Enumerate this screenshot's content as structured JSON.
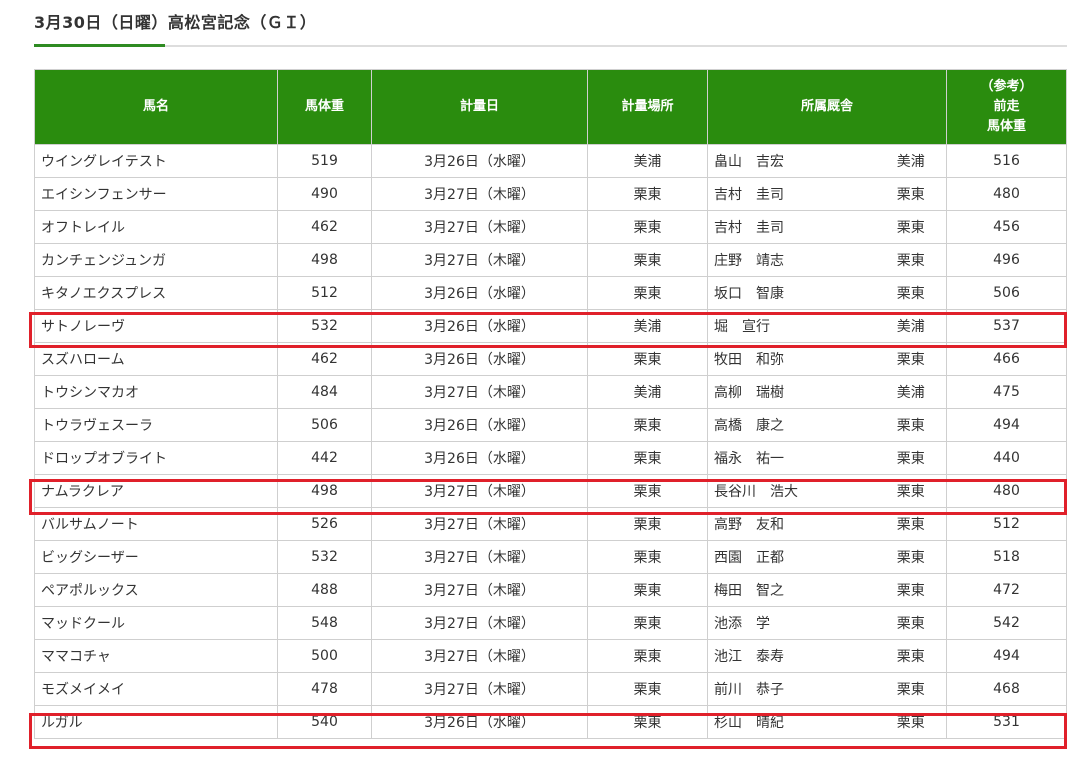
{
  "page_title": "3月30日（日曜）高松宮記念（ＧＩ）",
  "accent_color": "#2a8c0e",
  "highlight_color": "#e0202a",
  "table": {
    "headers": {
      "name": "馬名",
      "weight": "馬体重",
      "date": "計量日",
      "place": "計量場所",
      "stable": "所属厩舎",
      "prev_line1": "（参考）",
      "prev_line2": "前走",
      "prev_line3": "馬体重"
    },
    "rows": [
      {
        "name": "ウイングレイテスト",
        "weight": "519",
        "date": "3月26日（水曜）",
        "place": "美浦",
        "trainer": "畠山　吉宏",
        "base": "美浦",
        "prev": "516"
      },
      {
        "name": "エイシンフェンサー",
        "weight": "490",
        "date": "3月27日（木曜）",
        "place": "栗東",
        "trainer": "吉村　圭司",
        "base": "栗東",
        "prev": "480"
      },
      {
        "name": "オフトレイル",
        "weight": "462",
        "date": "3月27日（木曜）",
        "place": "栗東",
        "trainer": "吉村　圭司",
        "base": "栗東",
        "prev": "456"
      },
      {
        "name": "カンチェンジュンガ",
        "weight": "498",
        "date": "3月27日（木曜）",
        "place": "栗東",
        "trainer": "庄野　靖志",
        "base": "栗東",
        "prev": "496"
      },
      {
        "name": "キタノエクスプレス",
        "weight": "512",
        "date": "3月26日（水曜）",
        "place": "栗東",
        "trainer": "坂口　智康",
        "base": "栗東",
        "prev": "506"
      },
      {
        "name": "サトノレーヴ",
        "weight": "532",
        "date": "3月26日（水曜）",
        "place": "美浦",
        "trainer": "堀　宣行",
        "base": "美浦",
        "prev": "537"
      },
      {
        "name": "スズハローム",
        "weight": "462",
        "date": "3月26日（水曜）",
        "place": "栗東",
        "trainer": "牧田　和弥",
        "base": "栗東",
        "prev": "466"
      },
      {
        "name": "トウシンマカオ",
        "weight": "484",
        "date": "3月27日（木曜）",
        "place": "美浦",
        "trainer": "高柳　瑞樹",
        "base": "美浦",
        "prev": "475"
      },
      {
        "name": "トウラヴェスーラ",
        "weight": "506",
        "date": "3月26日（水曜）",
        "place": "栗東",
        "trainer": "高橋　康之",
        "base": "栗東",
        "prev": "494"
      },
      {
        "name": "ドロップオブライト",
        "weight": "442",
        "date": "3月26日（水曜）",
        "place": "栗東",
        "trainer": "福永　祐一",
        "base": "栗東",
        "prev": "440"
      },
      {
        "name": "ナムラクレア",
        "weight": "498",
        "date": "3月27日（木曜）",
        "place": "栗東",
        "trainer": "長谷川　浩大",
        "base": "栗東",
        "prev": "480"
      },
      {
        "name": "バルサムノート",
        "weight": "526",
        "date": "3月27日（木曜）",
        "place": "栗東",
        "trainer": "高野　友和",
        "base": "栗東",
        "prev": "512"
      },
      {
        "name": "ビッグシーザー",
        "weight": "532",
        "date": "3月27日（木曜）",
        "place": "栗東",
        "trainer": "西園　正都",
        "base": "栗東",
        "prev": "518"
      },
      {
        "name": "ペアポルックス",
        "weight": "488",
        "date": "3月27日（木曜）",
        "place": "栗東",
        "trainer": "梅田　智之",
        "base": "栗東",
        "prev": "472"
      },
      {
        "name": "マッドクール",
        "weight": "548",
        "date": "3月27日（木曜）",
        "place": "栗東",
        "trainer": "池添　学",
        "base": "栗東",
        "prev": "542"
      },
      {
        "name": "ママコチャ",
        "weight": "500",
        "date": "3月27日（木曜）",
        "place": "栗東",
        "trainer": "池江　泰寿",
        "base": "栗東",
        "prev": "494"
      },
      {
        "name": "モズメイメイ",
        "weight": "478",
        "date": "3月27日（木曜）",
        "place": "栗東",
        "trainer": "前川　恭子",
        "base": "栗東",
        "prev": "468"
      },
      {
        "name": "ルガル",
        "weight": "540",
        "date": "3月26日（水曜）",
        "place": "栗東",
        "trainer": "杉山　晴紀",
        "base": "栗東",
        "prev": "531"
      }
    ]
  }
}
